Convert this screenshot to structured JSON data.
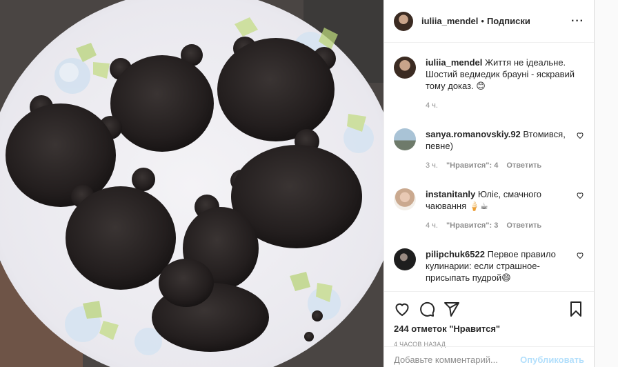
{
  "header": {
    "username": "iuliia_mendel",
    "separator": "•",
    "follow_label": "Подписки",
    "more_label": "···"
  },
  "caption": {
    "username": "iuliia_mendel",
    "text": "Життя не ідеальне. Шостий ведмедик брауні - яскравий тому доказ. 😊",
    "time": "4 ч."
  },
  "comments": [
    {
      "username": "sanya.romanovskiy.92",
      "text": "Втомився, певне)",
      "time": "3 ч.",
      "likes": "\"Нравится\": 4",
      "reply": "Ответить"
    },
    {
      "username": "instanitanly",
      "text": "Юліє, смачного чаювання 🍦☕",
      "time": "4 ч.",
      "likes": "\"Нравится\": 3",
      "reply": "Ответить"
    },
    {
      "username": "pilipchuk6522",
      "text": "Первое правило кулинарии: если страшное-присыпать пудрой😄",
      "time": "",
      "likes": "",
      "reply": ""
    }
  ],
  "actions": {
    "icons": [
      "heart-icon",
      "comment-icon",
      "share-icon",
      "bookmark-icon"
    ],
    "likes_text": "244 отметок \"Нравится\"",
    "timestamp": "4 часов назад"
  },
  "add_comment": {
    "placeholder": "Добавьте комментарий...",
    "post_label": "Опубликовать"
  },
  "colors": {
    "text": "#262626",
    "secondary": "#8e8e8e",
    "border": "#efefef",
    "post_button_disabled": "#b2dffc"
  }
}
